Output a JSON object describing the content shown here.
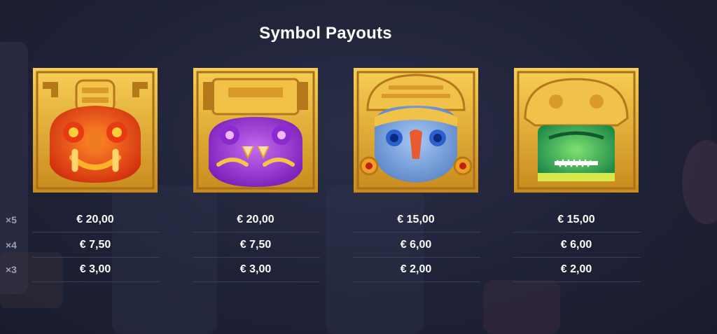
{
  "title": "Symbol Payouts",
  "symbols": [
    {
      "icon": "red-mask-icon",
      "color": "#e8501a"
    },
    {
      "icon": "purple-mask-icon",
      "color": "#9a2fd0"
    },
    {
      "icon": "blue-mask-icon",
      "color": "#6f9fd8"
    },
    {
      "icon": "green-mask-icon",
      "color": "#39b45a"
    }
  ],
  "rows": [
    {
      "label": "×5",
      "values": [
        "€ 20,00",
        "€ 20,00",
        "€ 15,00",
        "€ 15,00"
      ]
    },
    {
      "label": "×4",
      "values": [
        "€ 7,50",
        "€ 7,50",
        "€ 6,00",
        "€ 6,00"
      ]
    },
    {
      "label": "×3",
      "values": [
        "€ 3,00",
        "€ 3,00",
        "€ 2,00",
        "€ 2,00"
      ]
    }
  ]
}
